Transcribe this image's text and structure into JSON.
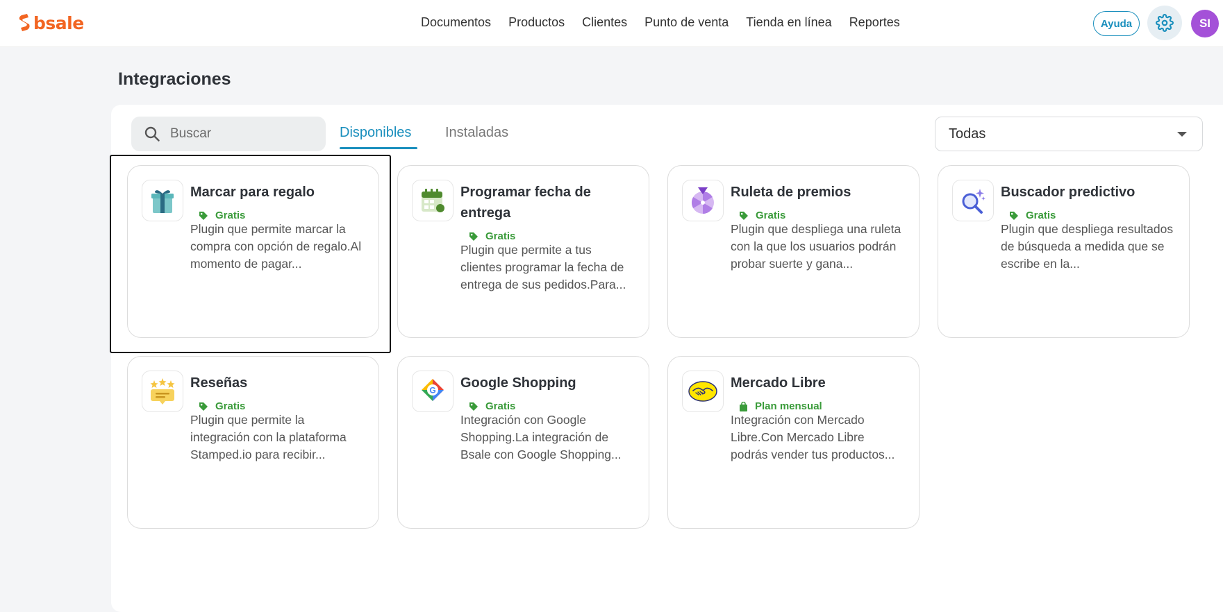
{
  "header": {
    "logo_text": "bsale",
    "nav": [
      "Documentos",
      "Productos",
      "Clientes",
      "Punto de venta",
      "Tienda en línea",
      "Reportes"
    ],
    "help_label": "Ayuda",
    "avatar_initials": "SI",
    "colors": {
      "brand": "#f26522",
      "accent": "#1a8fbd",
      "avatar": "#a451d8"
    }
  },
  "page": {
    "title": "Integraciones",
    "search_placeholder": "Buscar",
    "tabs": [
      {
        "label": "Disponibles",
        "active": true
      },
      {
        "label": "Instaladas",
        "active": false
      }
    ],
    "filter_value": "Todas"
  },
  "integrations": [
    {
      "title": "Marcar para regalo",
      "price": "Gratis",
      "price_icon": "tag-icon",
      "description": "Plugin que permite marcar la compra con opción de regalo.Al momento de pagar...",
      "icon": "gift-icon"
    },
    {
      "title": "Programar fecha de entrega",
      "price": "Gratis",
      "price_icon": "tag-icon",
      "description": "Plugin que permite a tus clientes programar la fecha de entrega de sus pedidos.Para...",
      "icon": "calendar-icon"
    },
    {
      "title": "Ruleta de premios",
      "price": "Gratis",
      "price_icon": "tag-icon",
      "description": "Plugin que despliega una ruleta con la que los usuarios podrán probar suerte y gana...",
      "icon": "prize-wheel-icon"
    },
    {
      "title": "Buscador predictivo",
      "price": "Gratis",
      "price_icon": "tag-icon",
      "description": "Plugin que despliega resultados de búsqueda a medida que se escribe en la...",
      "icon": "predictive-search-icon"
    },
    {
      "title": "Reseñas",
      "price": "Gratis",
      "price_icon": "tag-icon",
      "description": "Plugin que permite la integración con la plataforma Stamped.io para recibir...",
      "icon": "reviews-icon"
    },
    {
      "title": "Google Shopping",
      "price": "Gratis",
      "price_icon": "tag-icon",
      "description": "Integración con Google Shopping.La integración de Bsale con Google Shopping...",
      "icon": "google-shopping-icon"
    },
    {
      "title": "Mercado Libre",
      "price": "Plan mensual",
      "price_icon": "shopping-bag-icon",
      "description": "Integración con Mercado Libre.Con Mercado Libre podrás vender tus productos...",
      "icon": "mercado-libre-icon"
    }
  ]
}
